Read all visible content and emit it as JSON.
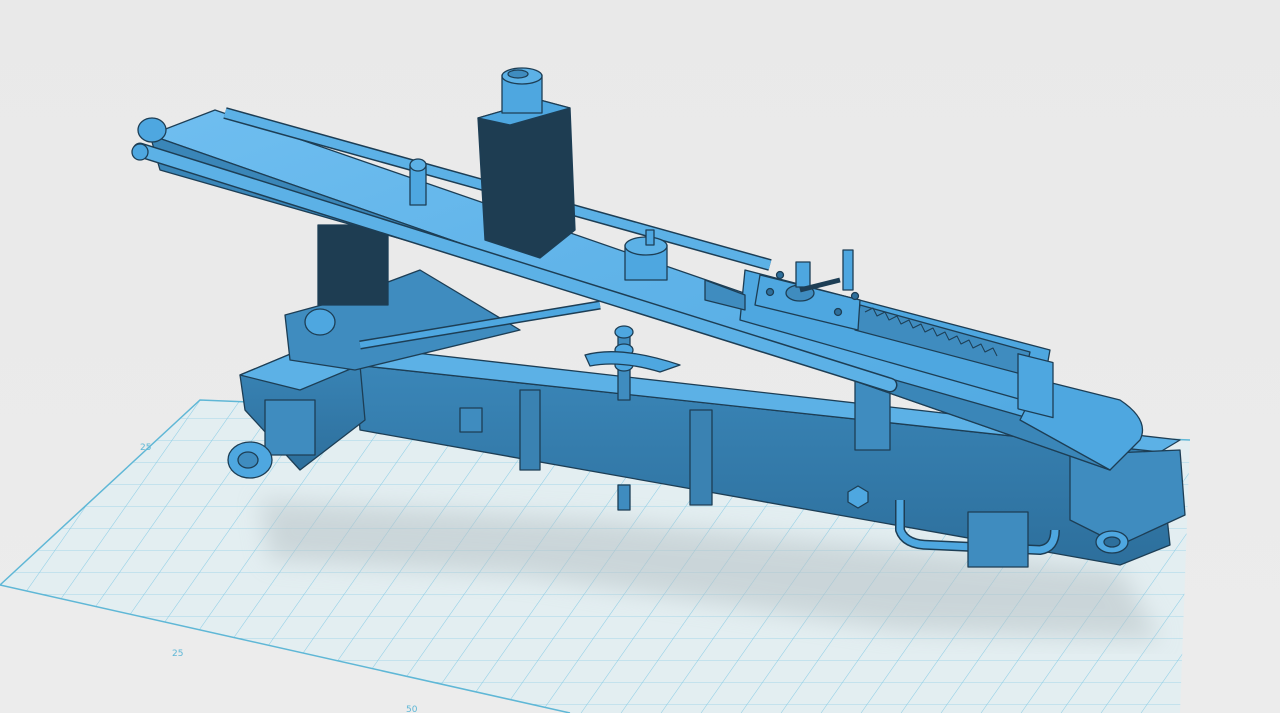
{
  "viewport": {
    "background_color": "#ebebeb",
    "model_color": "#4ea7e0",
    "model_shadow_color": "#2d6f9c",
    "grid_color": "#7cc7e3",
    "grid_fill": "#e3eef1"
  },
  "grid": {
    "labels": {
      "left": "25",
      "bottom_left": "25",
      "bottom": "50"
    }
  },
  "model": {
    "icon": "gun-carriage-model"
  }
}
